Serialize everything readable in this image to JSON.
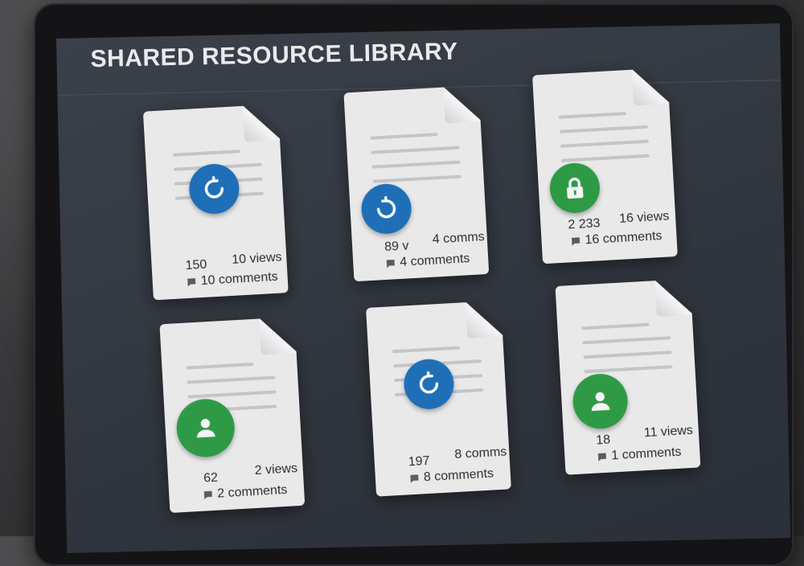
{
  "app": {
    "title": "SHARED RESOURCE LIBRARY"
  },
  "colors": {
    "screen_bg": "#30353d",
    "card_bg": "#e9e9ea",
    "refresh_badge": "#1f6fb8",
    "secure_badge": "#2e9a46"
  },
  "cards": [
    {
      "icon": "refresh-icon",
      "count": "150",
      "views": "10 views",
      "comments": "10 comments"
    },
    {
      "icon": "sync-icon",
      "count": "89 v",
      "views": "4 comms",
      "comments": "4 comments"
    },
    {
      "icon": "lock-icon",
      "count": "2 233",
      "views": "16 views",
      "comments": "16 comments"
    },
    {
      "icon": "user-icon",
      "count": "62",
      "views": "2 views",
      "comments": "2 comments"
    },
    {
      "icon": "refresh-icon",
      "count": "197",
      "views": "8 comms",
      "comments": "8 comments"
    },
    {
      "icon": "user-icon",
      "count": "18",
      "views": "11 views",
      "comments": "1 comments"
    }
  ]
}
